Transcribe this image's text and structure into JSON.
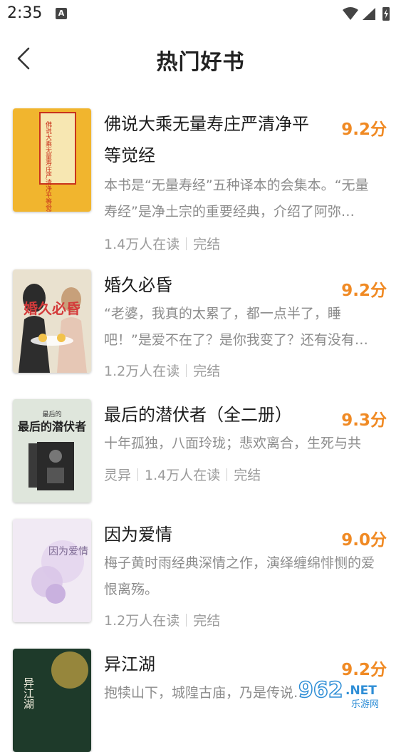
{
  "status_bar": {
    "time": "2:35",
    "notification_badge": "A"
  },
  "header": {
    "title": "热门好书"
  },
  "books": [
    {
      "title": "佛说大乘无量寿庄严清净平等觉经",
      "score": "9.2分",
      "desc": "本书是“无量寿经”五种译本的会集本。“无量寿经”是净土宗的重要经典，介绍了阿弥…",
      "readers": "1.4万人在读",
      "status": "完结",
      "cover_text": "佛说大乘无量寿庄严清净平等觉经"
    },
    {
      "title": "婚久必昏",
      "score": "9.2分",
      "desc": "“老婆，我真的太累了，都一点半了，睡吧！”是爱不在了？是你我变了？还有没有…",
      "readers": "1.2万人在读",
      "status": "完结",
      "cover_text": "婚久必昏"
    },
    {
      "title": "最后的潜伏者（全二册）",
      "score": "9.3分",
      "desc": "十年孤独，八面玲珑；悲欢离合，生死与共",
      "genre": "灵异",
      "readers": "1.4万人在读",
      "status": "完结",
      "cover_text": "最后的潜伏者"
    },
    {
      "title": "因为爱情",
      "score": "9.0分",
      "desc": "梅子黄时雨经典深情之作，演绎缠绵悱恻的爱恨离殇。",
      "readers": "1.2万人在读",
      "status": "完结",
      "cover_text": "因为爱情"
    },
    {
      "title": "异江湖",
      "score": "9.2分",
      "desc": "抱犊山下，城隍古庙，乃是传说…",
      "cover_text": "异江湖"
    }
  ],
  "watermark": {
    "text": "962.NET",
    "subtext": "乐游网"
  },
  "colors": {
    "score": "#f08a24",
    "desc": "#8c8c8c",
    "title": "#1c1c1c"
  }
}
